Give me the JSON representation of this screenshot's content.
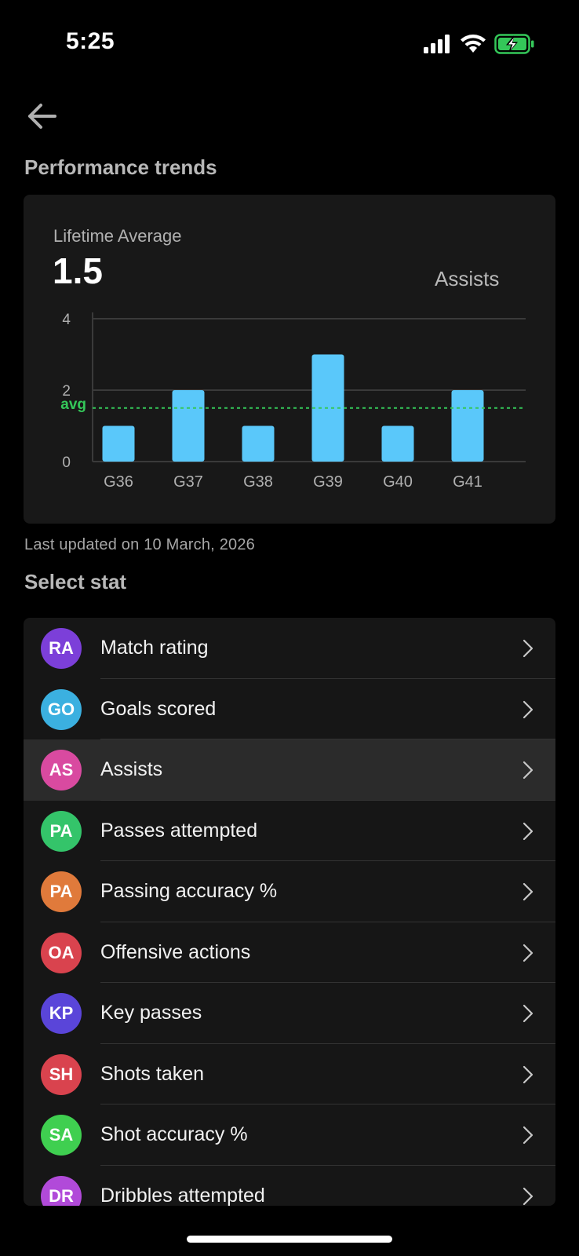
{
  "status_bar": {
    "time": "5:25",
    "icons": [
      "cellular-signal-icon",
      "wifi-icon",
      "battery-charging-icon"
    ],
    "battery_color": "#34c759"
  },
  "header": {
    "back_icon": "back-arrow-icon",
    "section_title": "Performance trends"
  },
  "summary": {
    "lifetime_label": "Lifetime Average",
    "lifetime_value": "1.5",
    "stat_name": "Assists"
  },
  "chart_data": {
    "type": "bar",
    "categories": [
      "G36",
      "G37",
      "G38",
      "G39",
      "G40",
      "G41"
    ],
    "values": [
      1,
      2,
      1,
      3,
      1,
      2
    ],
    "ylim": [
      0,
      4
    ],
    "yticks": [
      "0",
      "2",
      "4"
    ],
    "average": 1.5,
    "average_label": "avg",
    "bar_color": "#5ac8fa",
    "avg_color": "#34c759",
    "grid": true
  },
  "last_updated": "Last updated on 10 March, 2026",
  "select_title": "Select stat",
  "stats": [
    {
      "abbr": "RA",
      "label": "Match rating",
      "color": "#7c3fd9",
      "selected": false
    },
    {
      "abbr": "GO",
      "label": "Goals scored",
      "color": "#3bb0e0",
      "selected": false
    },
    {
      "abbr": "AS",
      "label": "Assists",
      "color": "#d94aa0",
      "selected": true
    },
    {
      "abbr": "PA",
      "label": "Passes attempted",
      "color": "#34c46a",
      "selected": false
    },
    {
      "abbr": "PA",
      "label": "Passing accuracy %",
      "color": "#e07a3b",
      "selected": false
    },
    {
      "abbr": "OA",
      "label": "Offensive actions",
      "color": "#d9434e",
      "selected": false
    },
    {
      "abbr": "KP",
      "label": "Key passes",
      "color": "#5a45d9",
      "selected": false
    },
    {
      "abbr": "SH",
      "label": "Shots taken",
      "color": "#d9434e",
      "selected": false
    },
    {
      "abbr": "SA",
      "label": "Shot accuracy %",
      "color": "#3fcf50",
      "selected": false
    },
    {
      "abbr": "DR",
      "label": "Dribbles attempted",
      "color": "#b14ad9",
      "selected": false
    }
  ]
}
